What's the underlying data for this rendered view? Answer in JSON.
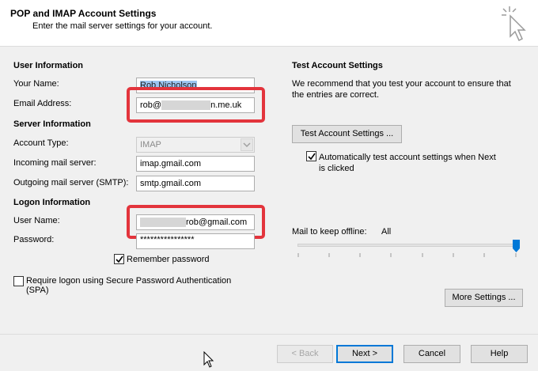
{
  "header": {
    "title": "POP and IMAP Account Settings",
    "subtitle": "Enter the mail server settings for your account."
  },
  "user_info": {
    "section": "User Information",
    "your_name_label": "Your Name:",
    "your_name_value": "Rob Nicholson",
    "email_label": "Email Address:",
    "email_prefix": "rob@",
    "email_suffix": "n.me.uk"
  },
  "server_info": {
    "section": "Server Information",
    "account_type_label": "Account Type:",
    "account_type_value": "IMAP",
    "incoming_label": "Incoming mail server:",
    "incoming_value": "imap.gmail.com",
    "outgoing_label": "Outgoing mail server (SMTP):",
    "outgoing_value": "smtp.gmail.com"
  },
  "logon_info": {
    "section": "Logon Information",
    "user_name_label": "User Name:",
    "user_name_suffix": "rob@gmail.com",
    "password_label": "Password:",
    "password_value": "****************",
    "remember_label": "Remember password",
    "spa_label_line1": "Require logon using Secure Password Authentication",
    "spa_label_line2": "(SPA)"
  },
  "test_settings": {
    "section": "Test Account Settings",
    "desc_line1": "We recommend that you test your account to ensure that",
    "desc_line2": "the entries are correct.",
    "test_button": "Test Account Settings ...",
    "auto_test_line1": "Automatically test account settings when Next",
    "auto_test_line2": "is clicked",
    "offline_label": "Mail to keep offline:",
    "offline_value": "All",
    "offline_level": 1.0
  },
  "buttons": {
    "more_settings": "More Settings ...",
    "back": "< Back",
    "next": "Next >",
    "cancel": "Cancel",
    "help": "Help"
  },
  "colors": {
    "highlight": "#e3343c",
    "accent": "#0078d7"
  }
}
